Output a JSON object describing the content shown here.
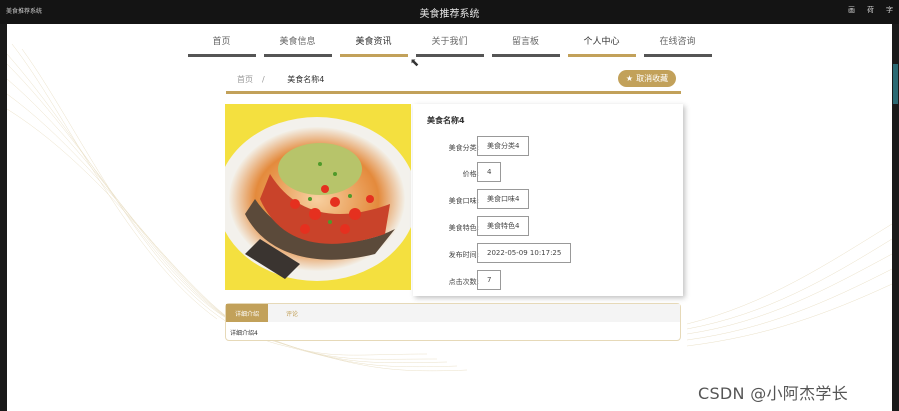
{
  "window": {
    "small_title": "美食推荐系统",
    "title": "美食推荐系统",
    "tray": [
      "画",
      "荷",
      "字"
    ]
  },
  "nav": {
    "items": [
      {
        "label": "首页"
      },
      {
        "label": "美食信息"
      },
      {
        "label": "美食资讯",
        "active": true
      },
      {
        "label": "关于我们"
      },
      {
        "label": "留言板"
      },
      {
        "label": "个人中心"
      },
      {
        "label": "在线咨询"
      }
    ]
  },
  "breadcrumb": {
    "home": "首页",
    "separator": "/",
    "current": "美食名称4"
  },
  "fav_button": {
    "icon": "star-icon",
    "label": "取消收藏"
  },
  "detail": {
    "name": "美食名称4",
    "fields": [
      {
        "label": "美食分类:",
        "value": "美食分类4"
      },
      {
        "label": "价格:",
        "value": "4"
      },
      {
        "label": "美食口味:",
        "value": "美食口味4"
      },
      {
        "label": "美食特色:",
        "value": "美食特色4"
      },
      {
        "label": "发布时间:",
        "value": "2022-05-09 10:17:25"
      },
      {
        "label": "点击次数:",
        "value": "7"
      }
    ]
  },
  "tabs": {
    "items": [
      {
        "label": "详细介绍",
        "active": true
      },
      {
        "label": "评论"
      }
    ],
    "content": "详细介绍4"
  },
  "watermark": "CSDN @小阿杰学长",
  "colors": {
    "accent": "#c2a15a",
    "topbar": "#141414"
  }
}
